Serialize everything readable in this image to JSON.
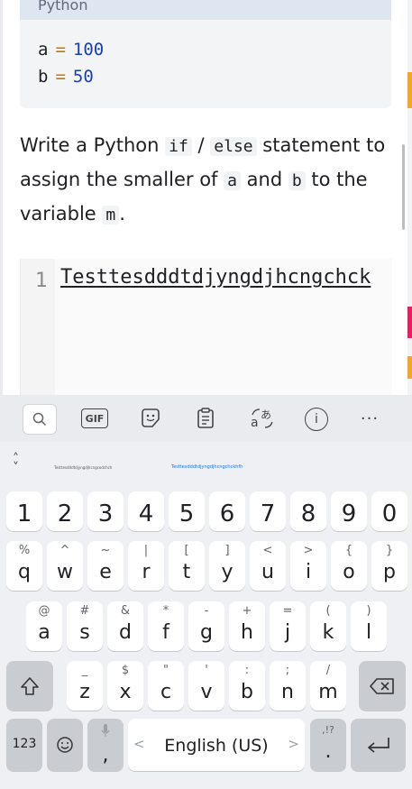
{
  "code_block": {
    "language": "Python",
    "lines": [
      {
        "name": "a",
        "op": "=",
        "value": "100"
      },
      {
        "name": "b",
        "op": "=",
        "value": "50"
      }
    ]
  },
  "prompt": {
    "t1": "Write a Python ",
    "c1": "if",
    "t2": " / ",
    "c2": "else",
    "t3": " statement to assign the smaller of ",
    "c3": "a",
    "t4": " and ",
    "c4": "b",
    "t5": " to the variable ",
    "c5": "m",
    "t6": "."
  },
  "editor": {
    "line_number": "1",
    "content": "Testtesdddtdjyngdjhcngchck"
  },
  "keyboard": {
    "toolbar": {
      "gif_label": "GIF",
      "icons": [
        "search-icon",
        "gif-icon",
        "sticker-icon",
        "clipboard-icon",
        "translate-icon",
        "info-icon",
        "more-icon"
      ]
    },
    "suggestions": [
      "Testtesdddtdjyngdjhcngcodchch",
      "Testtesdddtdjyngdjhcngchckhfh"
    ],
    "number_row": [
      "1",
      "2",
      "3",
      "4",
      "5",
      "6",
      "7",
      "8",
      "9",
      "0"
    ],
    "row1": [
      {
        "l": "q",
        "h": "%"
      },
      {
        "l": "w",
        "h": "^"
      },
      {
        "l": "e",
        "h": "~"
      },
      {
        "l": "r",
        "h": "|"
      },
      {
        "l": "t",
        "h": "["
      },
      {
        "l": "y",
        "h": "]"
      },
      {
        "l": "u",
        "h": "<"
      },
      {
        "l": "i",
        "h": ">"
      },
      {
        "l": "o",
        "h": "{"
      },
      {
        "l": "p",
        "h": "}"
      }
    ],
    "row2": [
      {
        "l": "a",
        "h": "@"
      },
      {
        "l": "s",
        "h": "#"
      },
      {
        "l": "d",
        "h": "&"
      },
      {
        "l": "f",
        "h": "*"
      },
      {
        "l": "g",
        "h": "-"
      },
      {
        "l": "h",
        "h": "+"
      },
      {
        "l": "j",
        "h": "="
      },
      {
        "l": "k",
        "h": "("
      },
      {
        "l": "l",
        "h": ")"
      }
    ],
    "row3": [
      {
        "l": "z",
        "h": "_"
      },
      {
        "l": "x",
        "h": "$"
      },
      {
        "l": "c",
        "h": "\""
      },
      {
        "l": "v",
        "h": "'"
      },
      {
        "l": "b",
        "h": ":"
      },
      {
        "l": "n",
        "h": ";"
      },
      {
        "l": "m",
        "h": "/"
      }
    ],
    "bottom": {
      "symbols_label": "123",
      "comma": ",",
      "space_label": "English (US)",
      "left_arrow": "<",
      "right_arrow": ">",
      "period": ".",
      "period_hint": ",!?"
    }
  }
}
